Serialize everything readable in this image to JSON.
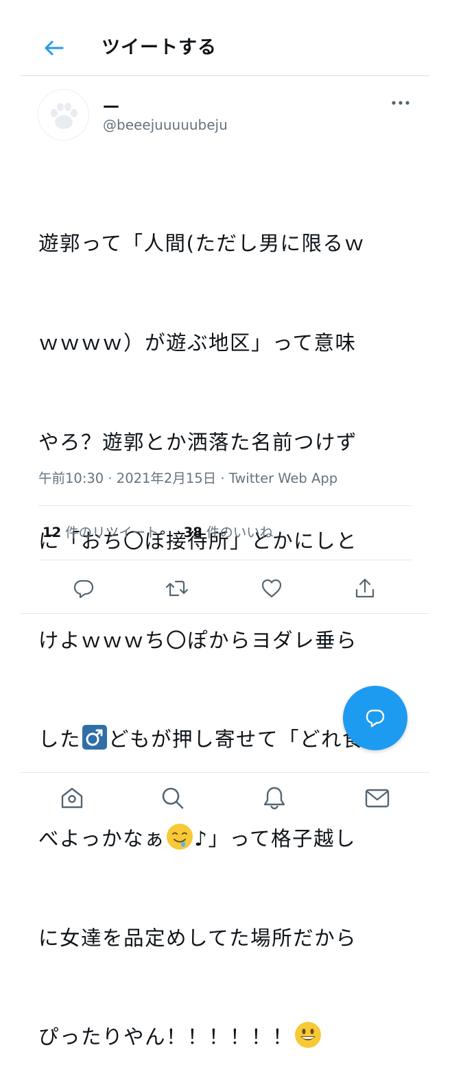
{
  "header": {
    "title": "ツイートする",
    "back_icon": "arrow-left-icon",
    "accent_color": "#1d9bf0"
  },
  "tweet": {
    "display_name": "—",
    "handle": "@beeejuuuuubeju",
    "text_lines": [
      "遊郭って「人間(ただし男に限るｗ",
      "ｗｗｗｗ）が遊ぶ地区」って意味",
      "やろ？遊郭とか洒落た名前つけず",
      "に「おち〇ぽ接待所」とかにしと",
      "けよｗｗｗち〇ぽからヨダレ垂ら"
    ],
    "line6_before": "した",
    "line6_emoji": "♂",
    "line6_after": "どもが押し寄せて「どれ食",
    "line7_before": "べよっかなぁ",
    "line7_after": "♪」って格子越し",
    "line8": "に女達を品定めしてた場所だから",
    "line9": "ぴったりやん！！！！！！",
    "meta": "午前10:30 · 2021年2月15日 · Twitter Web App"
  },
  "stats": {
    "retweets_count": "12",
    "retweets_label": "件のリツイート",
    "likes_count": "38",
    "likes_label": "件のいいね"
  },
  "actions": {
    "reply_icon": "reply-icon",
    "retweet_icon": "retweet-icon",
    "like_icon": "heart-icon",
    "share_icon": "share-icon"
  },
  "tabbar": {
    "items": [
      "home-icon",
      "search-icon",
      "notifications-icon",
      "messages-icon"
    ]
  },
  "colors": {
    "text": "#0f1419",
    "secondary": "#65727d",
    "icon": "#536471",
    "fab": "#1d9bf0"
  }
}
